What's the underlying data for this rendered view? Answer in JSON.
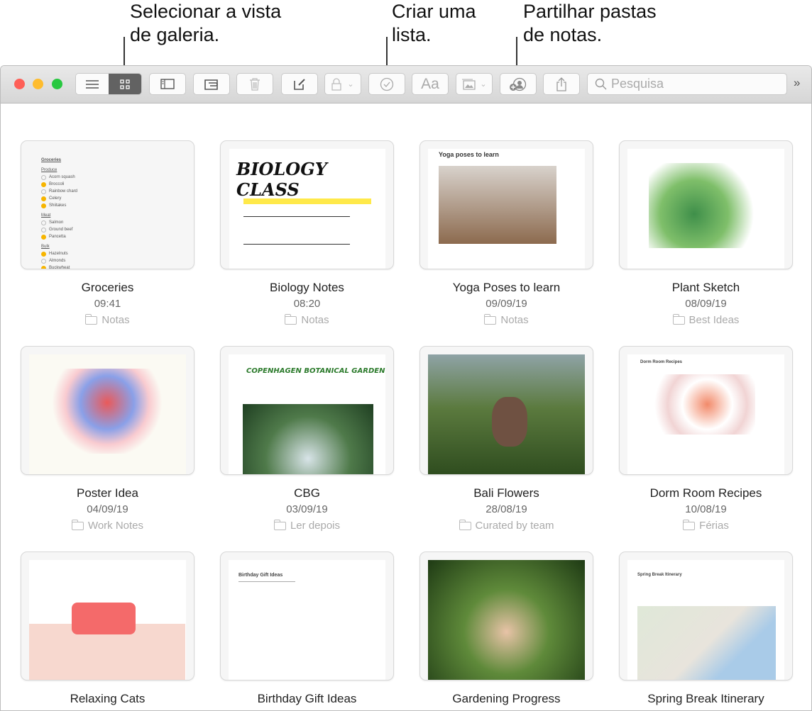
{
  "callouts": [
    {
      "text": "Selecionar a vista de galeria.",
      "line1": "Selecionar a vista",
      "line2": "de galeria."
    },
    {
      "line1": "Criar uma",
      "line2": "lista."
    },
    {
      "line1": "Partilhar pastas",
      "line2": "de notas."
    }
  ],
  "toolbar": {
    "view_list": "list-view-icon",
    "view_gallery": "gallery-view-icon",
    "search_placeholder": "Pesquisa",
    "format_label": "Aa",
    "more": "»"
  },
  "colors": {
    "close": "#fe5f57",
    "minimize": "#febc2e",
    "zoom": "#28c840",
    "gallery_selected": "#626262",
    "checked": "#f7b500"
  },
  "groceries_preview": {
    "title": "Groceries",
    "sections": [
      {
        "name": "Produce",
        "items": [
          {
            "t": "Acorn squash",
            "c": false
          },
          {
            "t": "Broccoli",
            "c": true
          },
          {
            "t": "Rainbow chard",
            "c": false
          },
          {
            "t": "Celery",
            "c": true
          },
          {
            "t": "Shiitakes",
            "c": true
          }
        ]
      },
      {
        "name": "Meat",
        "items": [
          {
            "t": "Salmon",
            "c": false
          },
          {
            "t": "Ground beef",
            "c": false
          },
          {
            "t": "Pancetta",
            "c": true
          }
        ]
      },
      {
        "name": "Bulk",
        "items": [
          {
            "t": "Hazelnuts",
            "c": true
          },
          {
            "t": "Almonds",
            "c": false
          },
          {
            "t": "Buckwheat",
            "c": true
          }
        ]
      }
    ]
  },
  "previews": {
    "biology": "BIOLOGY CLASS",
    "yoga": "Yoga poses to learn",
    "cbg": "COPENHAGEN BOTANICAL GARDEN",
    "dorm": "Dorm Room Recipes",
    "birthday": "Birthday Gift Ideas",
    "spring": "Spring Break Itinerary"
  },
  "notes": [
    {
      "title": "Groceries",
      "date": "09:41",
      "folder": "Notas"
    },
    {
      "title": "Biology Notes",
      "date": "08:20",
      "folder": "Notas"
    },
    {
      "title": "Yoga Poses to learn",
      "date": "09/09/19",
      "folder": "Notas"
    },
    {
      "title": "Plant Sketch",
      "date": "08/09/19",
      "folder": "Best Ideas"
    },
    {
      "title": "Poster Idea",
      "date": "04/09/19",
      "folder": "Work Notes"
    },
    {
      "title": "CBG",
      "date": "03/09/19",
      "folder": "Ler depois"
    },
    {
      "title": "Bali Flowers",
      "date": "28/08/19",
      "folder": "Curated by team"
    },
    {
      "title": "Dorm Room Recipes",
      "date": "10/08/19",
      "folder": "Férias"
    },
    {
      "title": "Relaxing Cats",
      "date": "",
      "folder": ""
    },
    {
      "title": "Birthday Gift Ideas",
      "date": "",
      "folder": ""
    },
    {
      "title": "Gardening Progress",
      "date": "",
      "folder": ""
    },
    {
      "title": "Spring Break Itinerary",
      "date": "",
      "folder": ""
    }
  ]
}
